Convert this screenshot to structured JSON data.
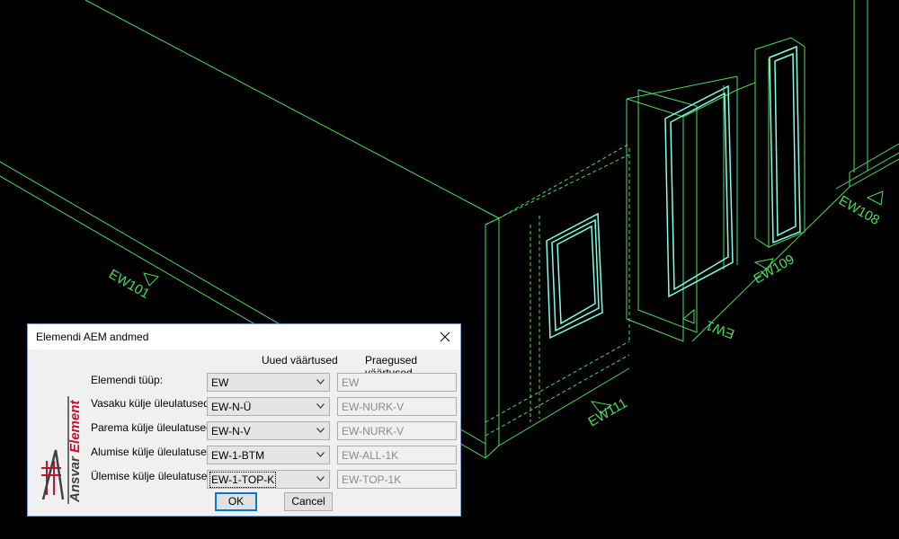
{
  "cad": {
    "labels": [
      "EW101",
      "EW111",
      "EW109",
      "EW108",
      "EW1"
    ]
  },
  "dialog": {
    "title": "Elemendi AEM andmed",
    "col_new": "Uued väärtused",
    "col_current": "Praegused väärtused",
    "logo_text": "Ansvar Element",
    "rows": [
      {
        "label": "Elemendi tüüp:",
        "new": "EW",
        "current": "EW"
      },
      {
        "label": "Vasaku külje üleulatused:",
        "new": "EW-N-Ü",
        "current": "EW-NURK-V"
      },
      {
        "label": "Parema külje üleulatused:",
        "new": "EW-N-V",
        "current": "EW-NURK-V"
      },
      {
        "label": "Alumise külje üleulatused:",
        "new": "EW-1-BTM",
        "current": "EW-ALL-1K"
      },
      {
        "label": "Ülemise külje üleulatused:",
        "new": "EW-1-TOP-K",
        "current": "EW-TOP-1K"
      }
    ],
    "ok_label": "OK",
    "cancel_label": "Cancel"
  },
  "colors": {
    "cad_green": "#4ddc5a",
    "cad_cyan": "#7fffe6",
    "background": "#000000"
  }
}
